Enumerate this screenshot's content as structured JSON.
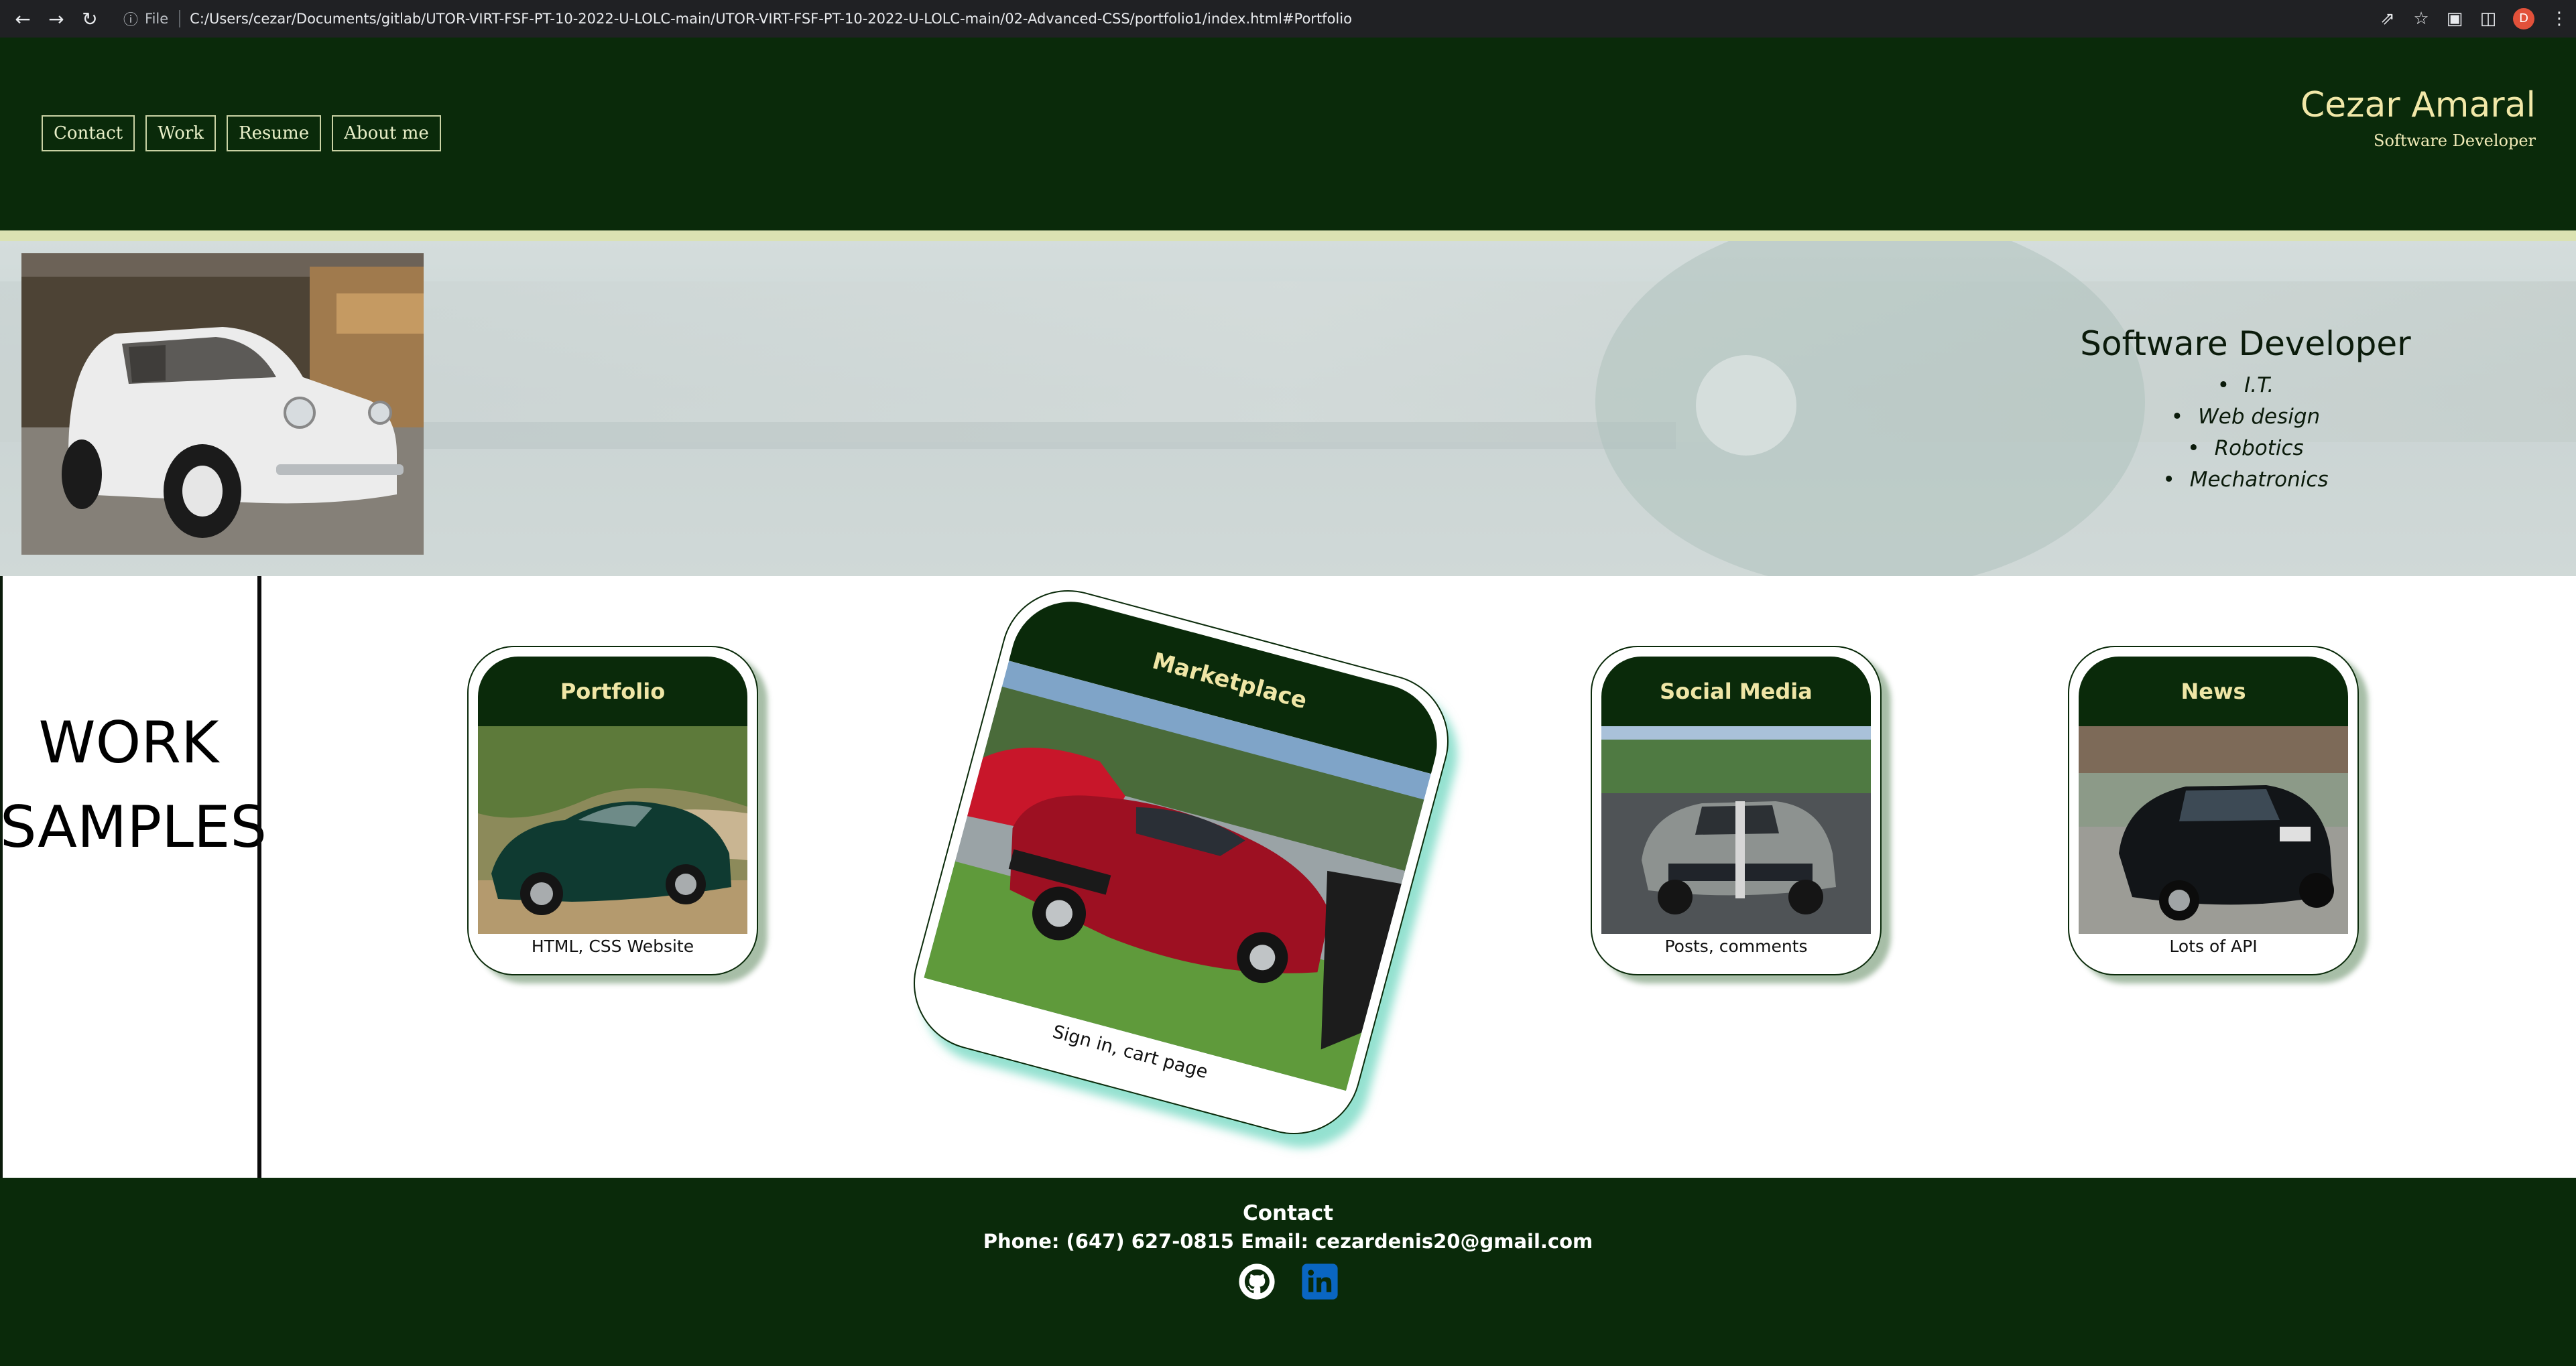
{
  "browser": {
    "file_label": "File",
    "url": "C:/Users/cezar/Documents/gitlab/UTOR-VIRT-FSF-PT-10-2022-U-LOLC-main/UTOR-VIRT-FSF-PT-10-2022-U-LOLC-main/02-Advanced-CSS/portfolio1/index.html#Portfolio",
    "profile_initial": "D"
  },
  "header": {
    "nav": [
      "Contact",
      "Work",
      "Resume",
      "About me"
    ],
    "name": "Cezar Amaral",
    "subtitle": "Software Developer"
  },
  "hero": {
    "title": "Software Developer",
    "skills": [
      "I.T.",
      "Web design",
      "Robotics",
      "Mechatronics"
    ]
  },
  "work": {
    "title_line1": "WORK",
    "title_line2": "SAMPLES",
    "cards": [
      {
        "title": "Portfolio",
        "caption": "HTML, CSS Website"
      },
      {
        "title": "Marketplace",
        "caption": "Sign in, cart page"
      },
      {
        "title": "Social Media",
        "caption": "Posts, comments"
      },
      {
        "title": "News",
        "caption": "Lots of API"
      }
    ]
  },
  "footer": {
    "title": "Contact",
    "line": "Phone: (647) 627-0815 Email: cezardenis20@gmail.com",
    "icons": [
      "github-icon",
      "linkedin-icon"
    ]
  },
  "colors": {
    "header_bg": "#0a2a0a",
    "accent_gold": "#efe6a6",
    "stripe": "#dbe2b2"
  }
}
